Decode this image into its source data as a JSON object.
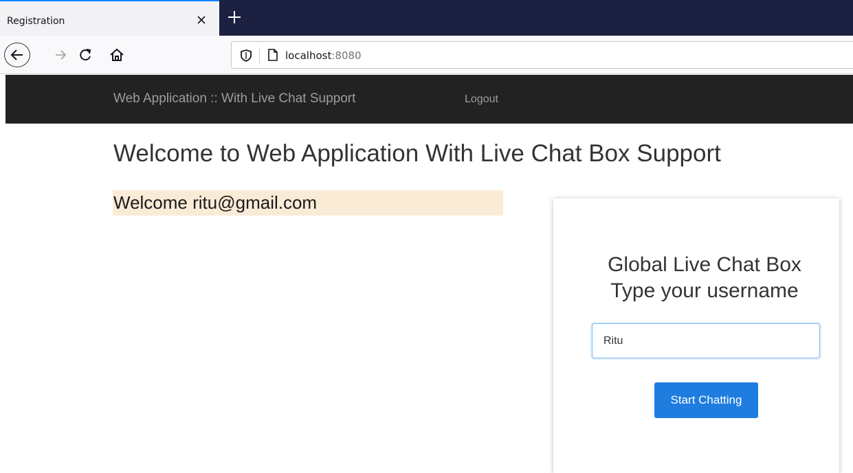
{
  "browser": {
    "tab_title": "Registration",
    "url_host": "localhost",
    "url_port": ":8080"
  },
  "navbar": {
    "brand": "Web Application :: With Live Chat Support",
    "logout": "Logout"
  },
  "main": {
    "title": "Welcome to Web Application With Live Chat Box Support",
    "welcome": "Welcome ritu@gmail.com"
  },
  "chat": {
    "title_line1": "Global Live Chat Box",
    "title_line2": "Type your username",
    "username_value": "Ritu",
    "start_label": "Start Chatting"
  },
  "colors": {
    "accent": "#1f7de0",
    "navbar_bg": "#222222",
    "welcome_bg": "#faebd7",
    "tabstrip_bg": "#1c2142"
  }
}
